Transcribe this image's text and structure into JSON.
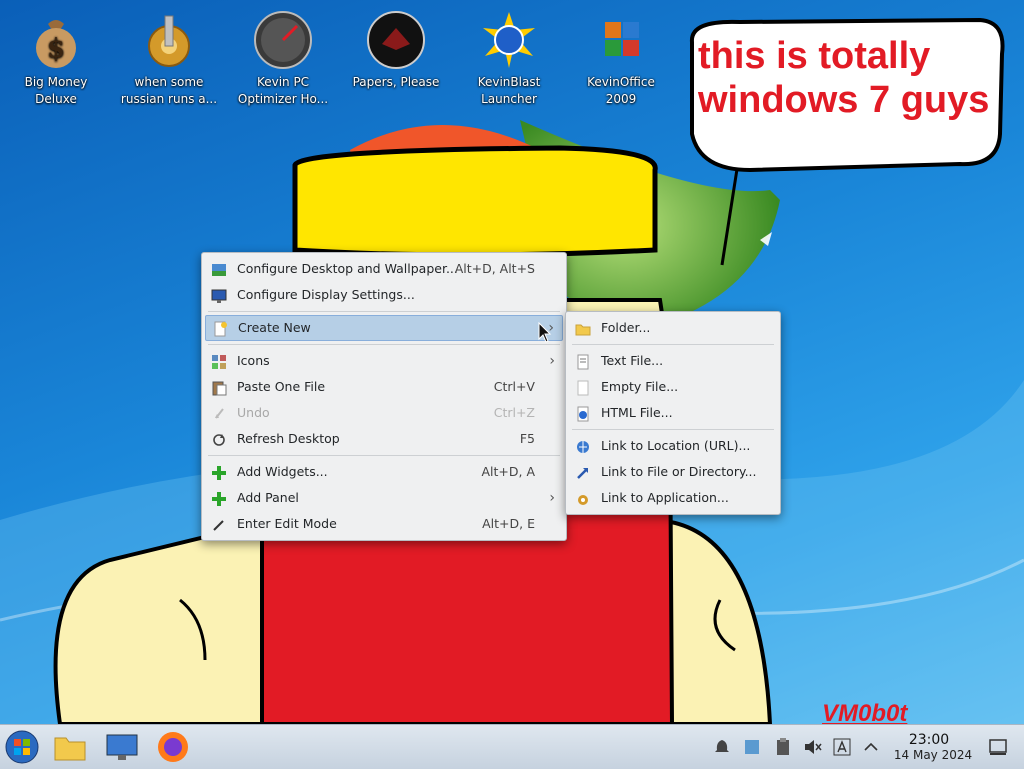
{
  "desktop_icons": [
    {
      "label_line1": "Big Money",
      "label_line2": "Deluxe",
      "icon": "money-bag-icon"
    },
    {
      "label_line1": "when some",
      "label_line2": "russian runs a...",
      "icon": "gear-icon"
    },
    {
      "label_line1": "Kevin PC",
      "label_line2": "Optimizer Ho...",
      "icon": "speedometer-icon"
    },
    {
      "label_line1": "Papers, Please",
      "label_line2": "",
      "icon": "emblem-icon"
    },
    {
      "label_line1": "KevinBlast",
      "label_line2": "Launcher",
      "icon": "globe-burst-icon"
    },
    {
      "label_line1": "KevinOffice",
      "label_line2": "2009",
      "icon": "office-icon"
    }
  ],
  "speech_bubble": {
    "line1": "this is totally",
    "line2": "windows 7 guys"
  },
  "signature": "VM0b0t",
  "context_menu": {
    "configure_desktop": {
      "label": "Configure Desktop and Wallpaper...",
      "shortcut": "Alt+D, Alt+S"
    },
    "configure_display": {
      "label": "Configure Display Settings..."
    },
    "create_new": {
      "label": "Create New"
    },
    "icons": {
      "label": "Icons"
    },
    "paste": {
      "label": "Paste One File",
      "shortcut": "Ctrl+V"
    },
    "undo": {
      "label": "Undo",
      "shortcut": "Ctrl+Z"
    },
    "refresh": {
      "label": "Refresh Desktop",
      "shortcut": "F5"
    },
    "add_widgets": {
      "label": "Add Widgets...",
      "shortcut": "Alt+D, A"
    },
    "add_panel": {
      "label": "Add Panel"
    },
    "edit_mode": {
      "label": "Enter Edit Mode",
      "shortcut": "Alt+D, E"
    }
  },
  "submenu": {
    "folder": "Folder...",
    "text_file": "Text File...",
    "empty_file": "Empty File...",
    "html_file": "HTML File...",
    "link_url": "Link to Location (URL)...",
    "link_file": "Link to File or Directory...",
    "link_app": "Link to Application..."
  },
  "taskbar": {
    "clock_time": "23:00",
    "clock_date": "14 May 2024"
  },
  "colors": {
    "accent_red": "#e21b25",
    "menu_bg": "#eff0f1",
    "highlight": "#b6cfe6"
  }
}
